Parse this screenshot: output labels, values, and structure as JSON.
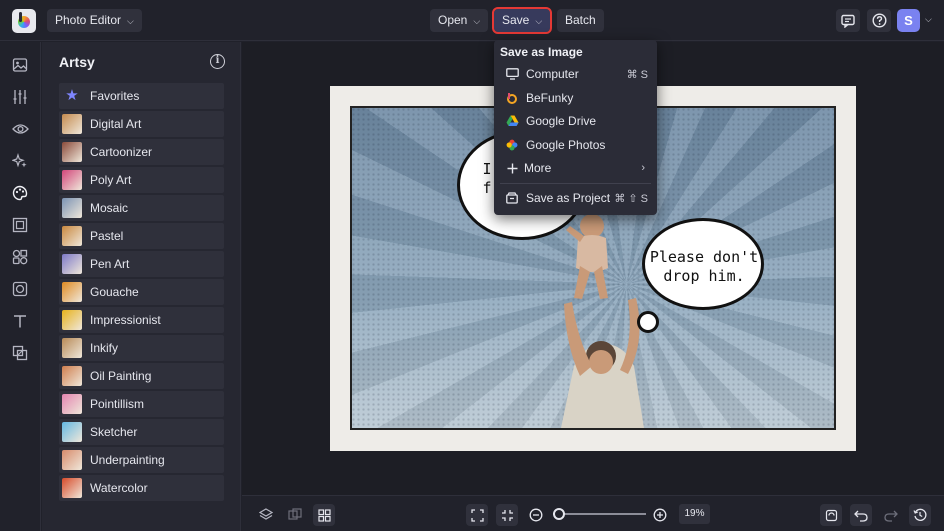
{
  "header": {
    "mode_label": "Photo Editor",
    "open_label": "Open",
    "save_label": "Save",
    "batch_label": "Batch",
    "user_initial": "S"
  },
  "panel": {
    "title": "Artsy",
    "items": [
      {
        "label": "Favorites",
        "thumb": "#7f86ff"
      },
      {
        "label": "Digital Art",
        "thumb": "#c48a4e"
      },
      {
        "label": "Cartoonizer",
        "thumb": "#8a4a3a"
      },
      {
        "label": "Poly Art",
        "thumb": "#d2467a"
      },
      {
        "label": "Mosaic",
        "thumb": "#7b93b4"
      },
      {
        "label": "Pastel",
        "thumb": "#c9883f"
      },
      {
        "label": "Pen Art",
        "thumb": "#7d79c8"
      },
      {
        "label": "Gouache",
        "thumb": "#e08b22"
      },
      {
        "label": "Impressionist",
        "thumb": "#e7b21b"
      },
      {
        "label": "Inkify",
        "thumb": "#b88a57"
      },
      {
        "label": "Oil Painting",
        "thumb": "#cf7e4e"
      },
      {
        "label": "Pointillism",
        "thumb": "#e384b0"
      },
      {
        "label": "Sketcher",
        "thumb": "#64b8e3"
      },
      {
        "label": "Underpainting",
        "thumb": "#d88b6b"
      },
      {
        "label": "Watercolor",
        "thumb": "#d84b2a"
      }
    ]
  },
  "save_menu": {
    "header": "Save as Image",
    "computer": {
      "label": "Computer",
      "shortcut": "⌘ S"
    },
    "befunky": {
      "label": "BeFunky"
    },
    "drive": {
      "label": "Google Drive"
    },
    "photos": {
      "label": "Google Photos"
    },
    "more": {
      "label": "More"
    },
    "project": {
      "label": "Save as Project",
      "shortcut": "⌘ ⇧ S"
    }
  },
  "canvas": {
    "bubble_left_text": "I\nf",
    "bubble_right_text": "Please don't\ndrop him."
  },
  "zoom": {
    "value": "19%"
  },
  "colors": {
    "accent": "#7a82f0",
    "highlight": "#e53935"
  }
}
